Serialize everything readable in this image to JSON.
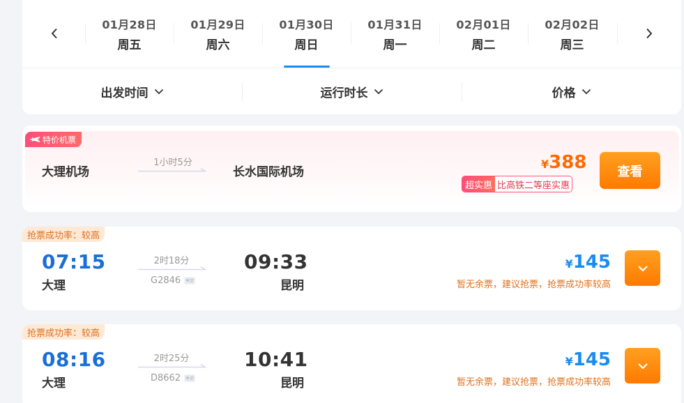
{
  "dates": [
    {
      "date": "01月28日",
      "weekday": "周五",
      "active": false
    },
    {
      "date": "01月29日",
      "weekday": "周六",
      "active": false
    },
    {
      "date": "01月30日",
      "weekday": "周日",
      "active": true
    },
    {
      "date": "01月31日",
      "weekday": "周一",
      "active": false
    },
    {
      "date": "02月01日",
      "weekday": "周二",
      "active": false
    },
    {
      "date": "02月02日",
      "weekday": "周三",
      "active": false
    }
  ],
  "filters": {
    "departure_time": "出发时间",
    "duration": "运行时长",
    "price": "价格"
  },
  "flight": {
    "badge": "特价机票",
    "from": "大理机场",
    "duration": "1小时5分",
    "to": "长水国际机场",
    "currency": "¥",
    "price": "388",
    "promo_label": "超实惠",
    "promo_text": "比高铁二等座实惠",
    "view_label": "查看"
  },
  "trains": [
    {
      "rate_tag": "抢票成功率：较高",
      "dep_time": "07:15",
      "dep_city": "大理",
      "duration": "2时18分",
      "train_no": "G2846",
      "arr_time": "09:33",
      "arr_city": "昆明",
      "currency": "¥",
      "price": "145",
      "note": "暂无余票，建议抢票，抢票成功率较高"
    },
    {
      "rate_tag": "抢票成功率：较高",
      "dep_time": "08:16",
      "dep_city": "大理",
      "duration": "2时25分",
      "train_no": "D8662",
      "arr_time": "10:41",
      "arr_city": "昆明",
      "currency": "¥",
      "price": "145",
      "note": "暂无余票，建议抢票，抢票成功率较高"
    }
  ],
  "colors": {
    "accent_blue": "#1a8cf0",
    "orange": "#ff7a00",
    "promo_pink": "#ff4d79"
  }
}
